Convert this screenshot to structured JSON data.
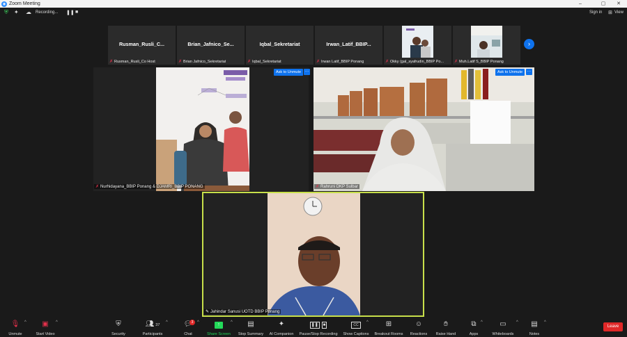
{
  "window": {
    "title": "Zoom Meeting",
    "minimize": "–",
    "maximize": "▢",
    "close": "✕"
  },
  "topbar": {
    "recording_label": "Recording...",
    "signin": "Sign in",
    "view_label": "View"
  },
  "strip": [
    {
      "big_name": "Rusman_Rusli_C...",
      "label": "Rusman_Rusli_Co Host"
    },
    {
      "big_name": "Brian_Jafnico_Se...",
      "label": "Brian Jafnico_Sekretariat"
    },
    {
      "big_name": "Iqbal_Sekretariat",
      "label": "Iqbal_Sekretariat"
    },
    {
      "big_name": "Irwan_Latif_BBIP...",
      "label": "Irwan Latif_BBIP Ponang"
    },
    {
      "big_name": "",
      "label": "Okky (gal_syafrudin_BBIP Po..."
    },
    {
      "big_name": "",
      "label": "Muh.Latif S_BBIP Ponang"
    }
  ],
  "main_tiles": [
    {
      "label": "Nurhidayana_BBIP Ponang & DJAMRI_BBIP PONANG",
      "ask": "Ask to Unmute",
      "more": "···"
    },
    {
      "label": "Rahruni DKP Sulbar",
      "ask": "Ask to Unmute",
      "more": "···"
    },
    {
      "label": "Jahindar Sanusi UOTD BBIP Ponang"
    }
  ],
  "toolbar": {
    "unmute": "Unmute",
    "start_video": "Start Video",
    "security": "Security",
    "participants": "Participants",
    "participants_count": "37",
    "chat": "Chat",
    "chat_badge": "3",
    "share_screen": "Share Screen",
    "stop_summary": "Stop Summary",
    "ai_companion": "AI Companion",
    "pause_stop_recording": "Pause/Stop Recording",
    "show_captions": "Show Captions",
    "breakout_rooms": "Breakout Rooms",
    "reactions": "Reactions",
    "raise_hand": "Raise Hand",
    "apps": "Apps",
    "whiteboards": "Whiteboards",
    "notes": "Notes",
    "leave": "Leave"
  },
  "colors": {
    "accent": "#0e72ed",
    "leave": "#e02828",
    "active_speaker": "#c8e04a",
    "share_green": "#23d959",
    "muted_red": "#e0304a"
  }
}
